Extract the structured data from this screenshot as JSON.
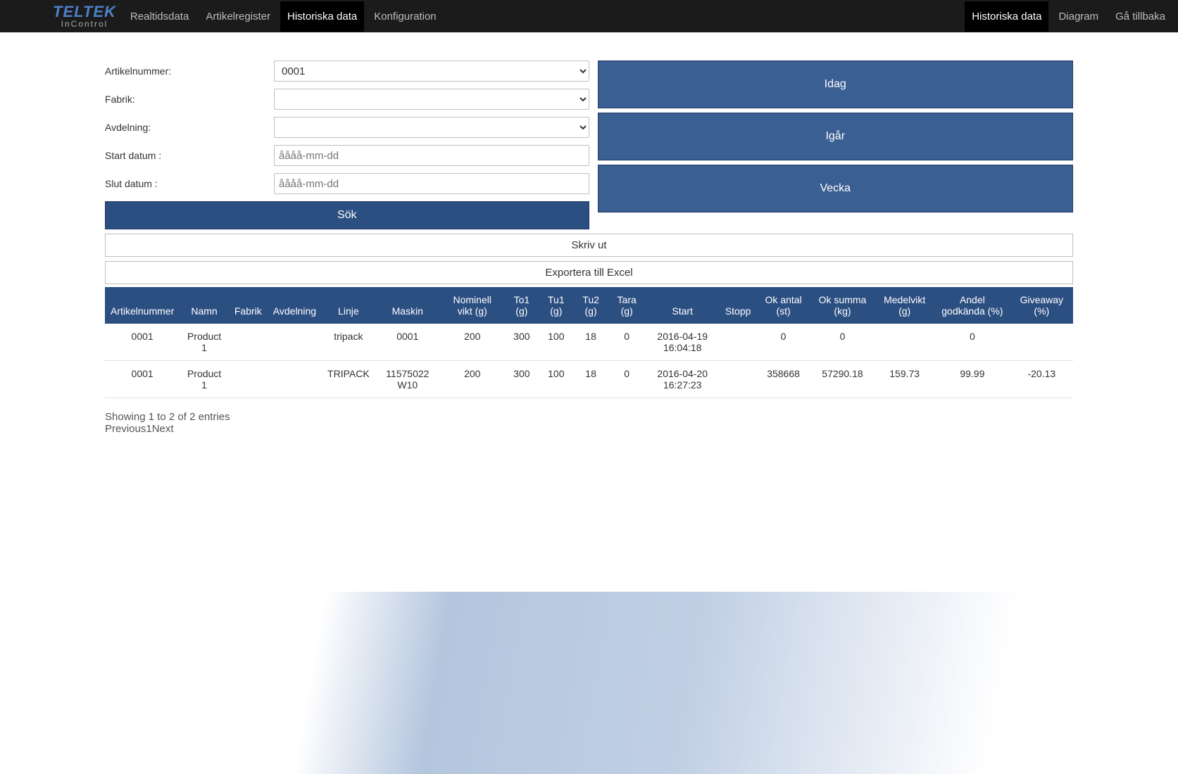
{
  "logo": {
    "main": "TELTEK",
    "sub": "InControl"
  },
  "nav_left": [
    {
      "label": "Realtidsdata",
      "active": false
    },
    {
      "label": "Artikelregister",
      "active": false
    },
    {
      "label": "Historiska data",
      "active": true
    },
    {
      "label": "Konfiguration",
      "active": false
    }
  ],
  "nav_right": [
    {
      "label": "Historiska data",
      "active": true
    },
    {
      "label": "Diagram",
      "active": false
    },
    {
      "label": "Gå tillbaka",
      "active": false
    }
  ],
  "filters": {
    "artikelnummer_label": "Artikelnummer:",
    "artikelnummer_value": "0001",
    "fabrik_label": "Fabrik:",
    "fabrik_value": "",
    "avdelning_label": "Avdelning:",
    "avdelning_value": "",
    "start_label": "Start datum :",
    "start_placeholder": "åååå-mm-dd",
    "start_value": "",
    "slut_label": "Slut datum :",
    "slut_placeholder": "åååå-mm-dd",
    "slut_value": ""
  },
  "buttons": {
    "sok": "Sök",
    "idag": "Idag",
    "igar": "Igår",
    "vecka": "Vecka",
    "skriv_ut": "Skriv ut",
    "export": "Exportera till Excel"
  },
  "table": {
    "headers": [
      "Artikelnummer",
      "Namn",
      "Fabrik",
      "Avdelning",
      "Linje",
      "Maskin",
      "Nominell vikt (g)",
      "To1 (g)",
      "Tu1 (g)",
      "Tu2 (g)",
      "Tara (g)",
      "Start",
      "Stopp",
      "Ok antal (st)",
      "Ok summa (kg)",
      "Medelvikt (g)",
      "Andel godkända (%)",
      "Giveaway (%)"
    ],
    "rows": [
      {
        "cells": [
          "0001",
          "Product 1",
          "",
          "",
          "tripack",
          "0001",
          "200",
          "300",
          "100",
          "18",
          "0",
          "2016-04-19 16:04:18",
          "",
          "0",
          "0",
          "",
          "0",
          ""
        ]
      },
      {
        "cells": [
          "0001",
          "Product 1",
          "",
          "",
          "TRIPACK",
          "11575022 W10",
          "200",
          "300",
          "100",
          "18",
          "0",
          "2016-04-20 16:27:23",
          "",
          "358668",
          "57290.18",
          "159.73",
          "99.99",
          "-20.13"
        ]
      }
    ]
  },
  "pager": {
    "info": "Showing 1 to 2 of 2 entries",
    "previous": "Previous",
    "page": "1",
    "next": "Next"
  }
}
